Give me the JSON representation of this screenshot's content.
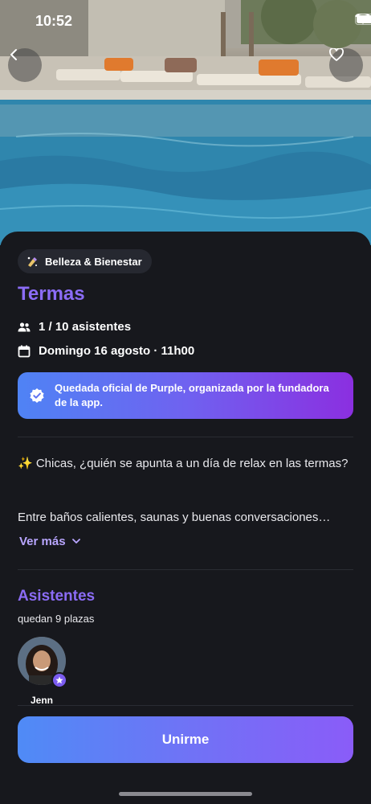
{
  "status_bar": {
    "time": "10:52"
  },
  "hero": {
    "image": "pool-resort-photo",
    "back_icon": "chevron-left-icon",
    "favorite_icon": "heart-outline-icon"
  },
  "event": {
    "category": {
      "icon": "sparkle-bottle-icon",
      "label": "Belleza & Bienestar"
    },
    "title": "Termas",
    "attendees_text": "1 / 10 asistentes",
    "date_text": "Domingo 16 agosto · 11h00",
    "official_banner": "Quedada oficial de Purple, organizada por la fundadora de la app.",
    "description_line1": "✨  Chicas, ¿quién se apunta a un día de relax en las termas?",
    "description_line2": "Entre baños calientes, saunas y buenas conversaciones…",
    "see_more": "Ver más"
  },
  "attendees_section": {
    "title": "Asistentes",
    "spots_left": "quedan 9 plazas",
    "people": [
      {
        "name": "Jenn",
        "badge_icon": "star-icon"
      }
    ]
  },
  "cta": {
    "label": "Unirme"
  },
  "colors": {
    "accent": "#8b6cf6",
    "background": "#17181d",
    "gradient_start": "#4f8bf6",
    "gradient_end": "#8a5cf8"
  }
}
